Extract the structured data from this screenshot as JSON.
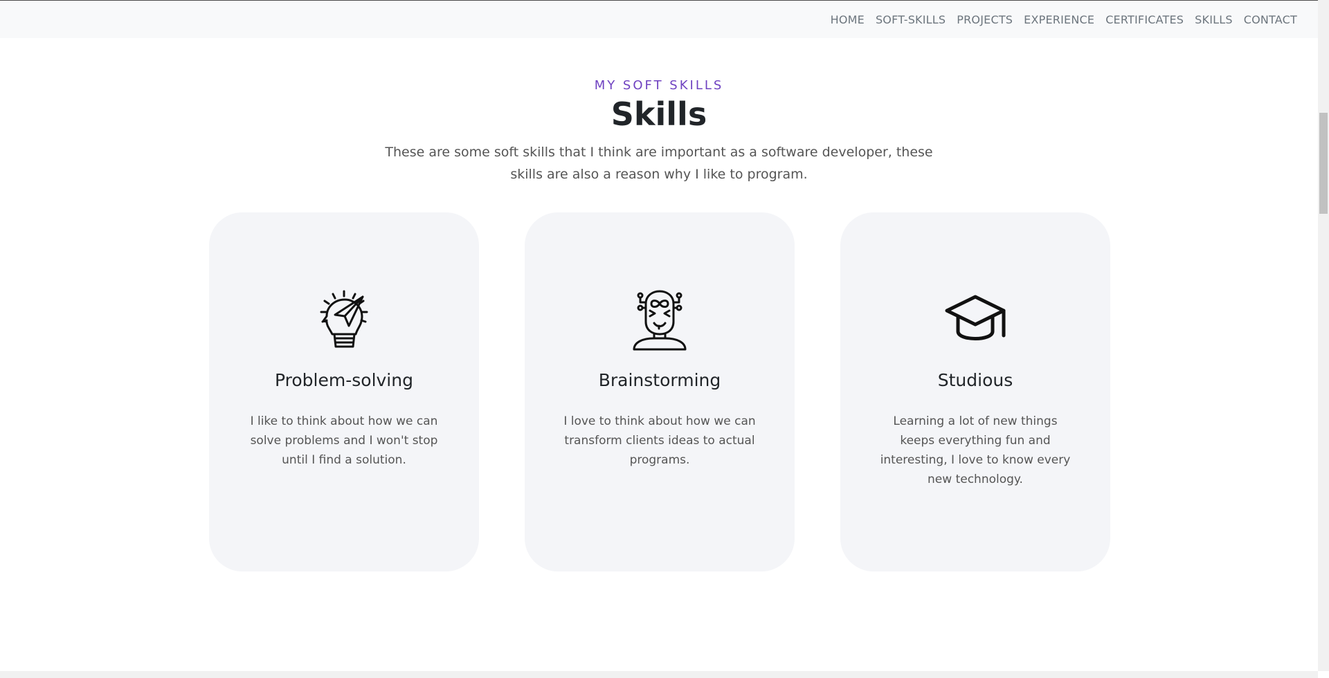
{
  "nav": {
    "items": [
      "HOME",
      "SOFT-SKILLS",
      "PROJECTS",
      "EXPERIENCE",
      "CERTIFICATES",
      "SKILLS",
      "CONTACT"
    ]
  },
  "section": {
    "eyebrow": "MY SOFT SKILLS",
    "title": "Skills",
    "intro": "These are some soft skills that I think are important as a software developer, these skills are also a reason why I like to program."
  },
  "cards": [
    {
      "icon": "lightbulb-head-paper-plane-icon",
      "title": "Problem-solving",
      "text": "I like to think about how we can solve problems and I won't stop until I find a solution."
    },
    {
      "icon": "robot-head-infinity-icon",
      "title": "Brainstorming",
      "text": "I love to think about how we can transform clients ideas to actual programs."
    },
    {
      "icon": "graduation-cap-icon",
      "title": "Studious",
      "text": "Learning a lot of new things keeps everything fun and interesting, I love to know every new technology."
    }
  ],
  "colors": {
    "accent": "#6f42c1",
    "card_bg": "#f4f5f8",
    "nav_bg": "#f8f9fa"
  }
}
